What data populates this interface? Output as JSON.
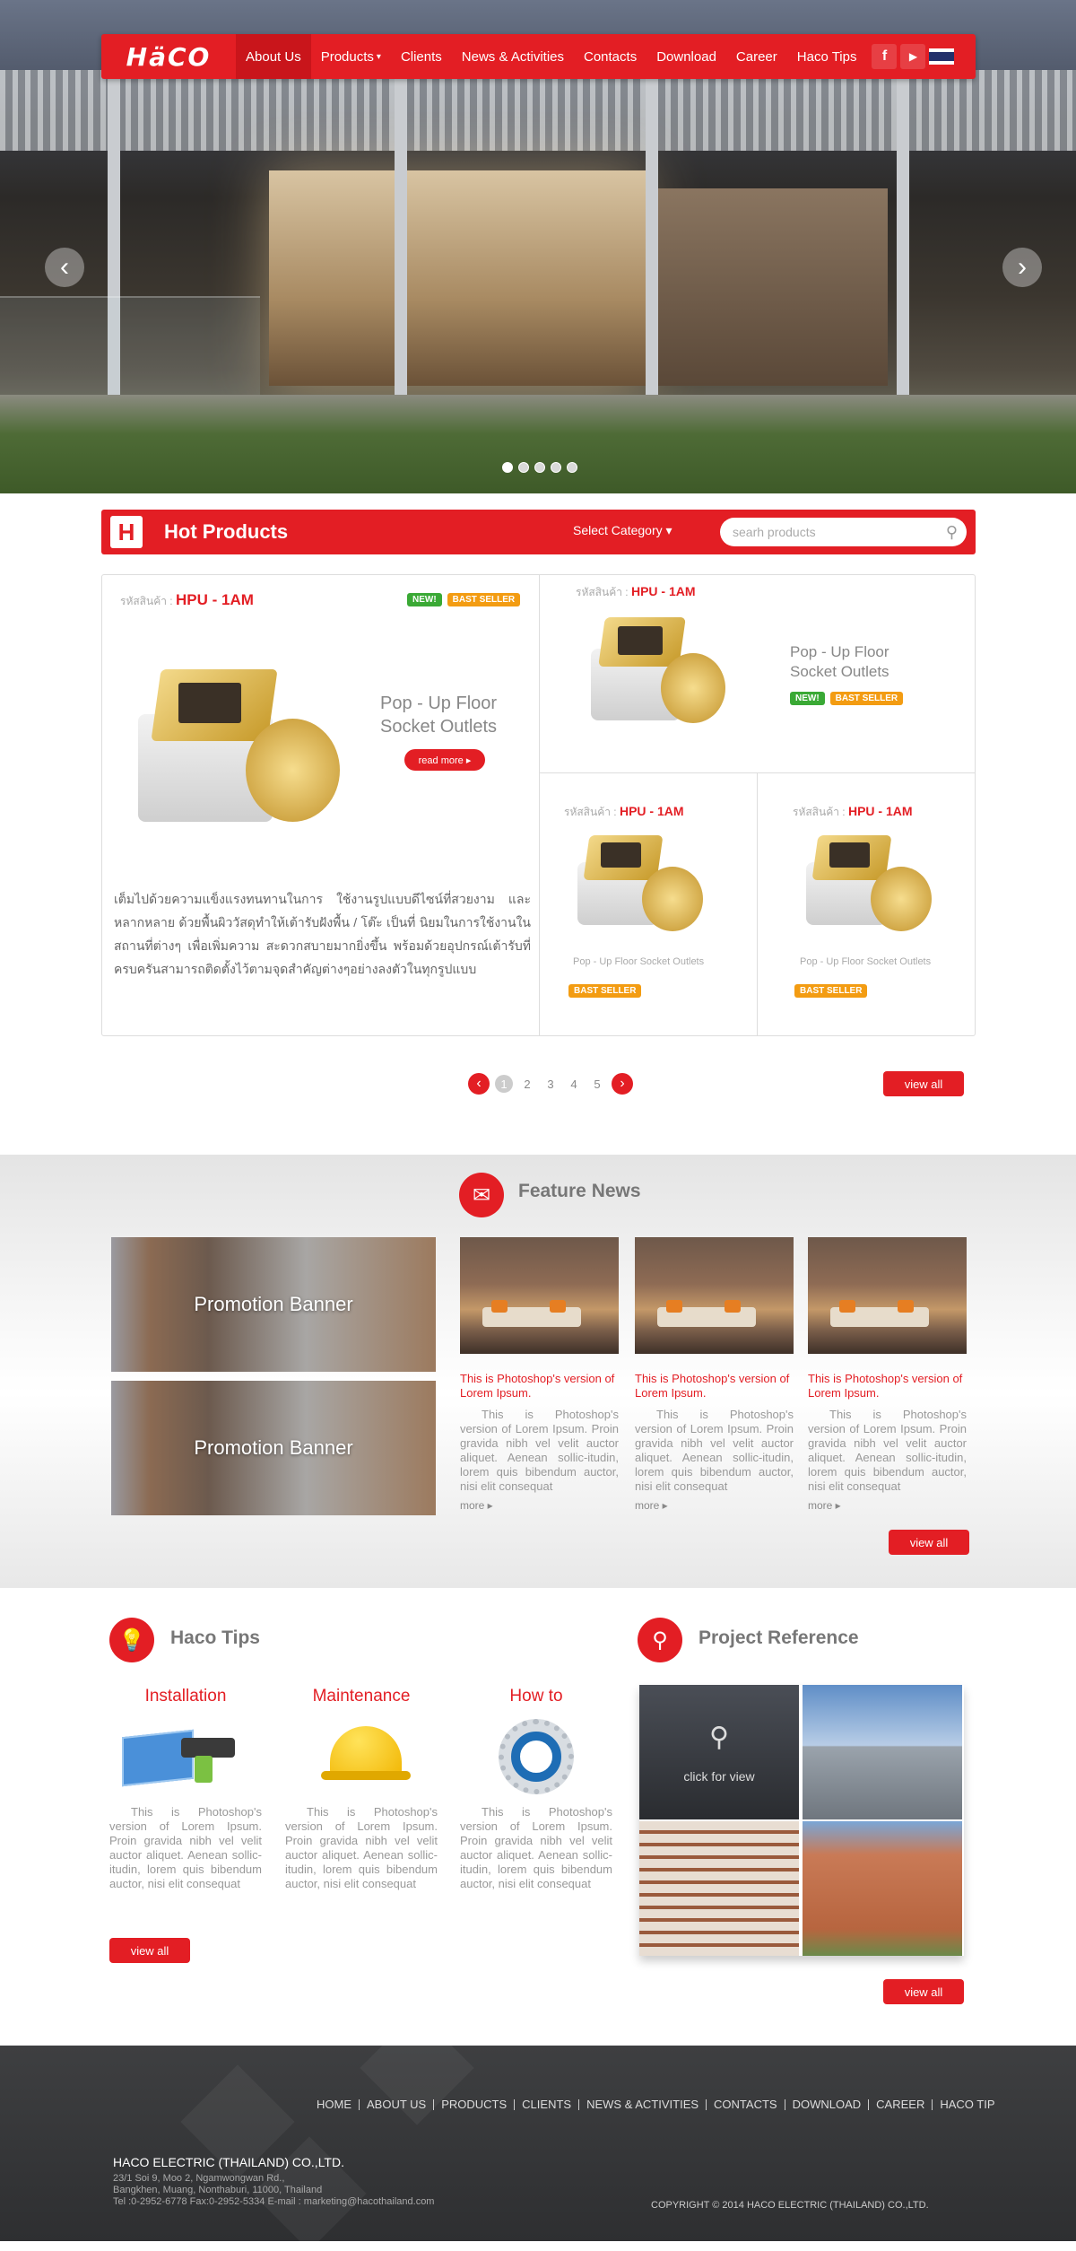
{
  "nav": {
    "logo": "HäCO",
    "items": [
      "About Us",
      "Products",
      "Clients",
      "News & Activities",
      "Contacts",
      "Download",
      "Career",
      "Haco Tips"
    ],
    "products_caret": "▾",
    "social": {
      "facebook": "f",
      "youtube": "▶",
      "thai_flag": ""
    }
  },
  "hero": {
    "prev": "‹",
    "next": "›",
    "dots": 5,
    "active_dot": 0
  },
  "hot": {
    "title": "Hot Products",
    "category": "Select Category ▾",
    "search_placeholder": "searh products",
    "code_prefix": "รหัสสินค้า : ",
    "featured": {
      "code": "HPU - 1AM",
      "name_line1": "Pop - Up Floor",
      "name_line2": "Socket Outlets",
      "read_more": "read more ▸",
      "badge_new": "NEW!",
      "badge_best": "BAST SELLER",
      "desc": "เต็มไปด้วยความแข็งแรงทนทานในการ         ใช้งานรูปแบบดีไซน์ที่สวยงาม และหลากหลาย ด้วยพื้นผิววัสดุทำให้เต้ารับฝังพื้น / โต๊ะ เป็นที่ นิยมในการใช้งานในสถานที่ต่างๆ เพื่อเพิ่มความ สะดวกสบายมากยิ่งขึ้น พร้อมด้วยอุปกรณ์เต้ารับที่ครบครันสามารถติดตั้งไว้ตามจุดสำคัญต่างๆอย่างลงตัวในทุกรูปแบบ"
    },
    "top_right": {
      "code": "HPU - 1AM",
      "name_line1": "Pop - Up Floor",
      "name_line2": "Socket Outlets",
      "badge_new": "NEW!",
      "badge_best": "BAST SELLER"
    },
    "bottom": [
      {
        "code": "HPU - 1AM",
        "name": "Pop - Up Floor Socket Outlets",
        "badge_best": "BAST SELLER"
      },
      {
        "code": "HPU - 1AM",
        "name": "Pop - Up Floor Socket Outlets",
        "badge_best": "BAST SELLER"
      }
    ],
    "pager": {
      "prev": "‹",
      "next": "›",
      "pages": [
        "1",
        "2",
        "3",
        "4",
        "5"
      ],
      "current": "1"
    },
    "view_all": "view all"
  },
  "feature": {
    "title": "Feature News",
    "banners": [
      "Promotion Banner",
      "Promotion Banner"
    ],
    "news": [
      {
        "title": "This is Photoshop's version of Lorem Ipsum.",
        "body": "This is Photoshop's version of Lorem Ipsum. Proin gravida nibh vel velit auctor aliquet. Aenean sollic-itudin, lorem quis bibendum auctor, nisi elit consequat",
        "more": "more ▸"
      },
      {
        "title": "This is Photoshop's version of Lorem Ipsum.",
        "body": "This is Photoshop's version of Lorem Ipsum. Proin gravida nibh vel velit auctor aliquet. Aenean sollic-itudin, lorem quis bibendum auctor, nisi elit consequat",
        "more": "more ▸"
      },
      {
        "title": "This is Photoshop's version of Lorem Ipsum.",
        "body": "This is Photoshop's version of Lorem Ipsum. Proin gravida nibh vel velit auctor aliquet. Aenean sollic-itudin, lorem quis bibendum auctor, nisi elit consequat",
        "more": "more ▸"
      }
    ],
    "view_all": "view all"
  },
  "tips": {
    "title": "Haco Tips",
    "items": [
      {
        "title": "Installation",
        "body": "This is Photoshop's version of Lorem Ipsum. Proin gravida nibh vel velit auctor aliquet. Aenean sollic-itudin, lorem quis bibendum auctor, nisi elit consequat"
      },
      {
        "title": "Maintenance",
        "body": "This is Photoshop's version of Lorem Ipsum. Proin gravida nibh vel velit auctor aliquet. Aenean sollic-itudin, lorem quis bibendum auctor, nisi elit consequat"
      },
      {
        "title": "How to",
        "body": "This is Photoshop's version of Lorem Ipsum. Proin gravida nibh vel velit auctor aliquet. Aenean sollic-itudin, lorem quis bibendum auctor, nisi elit consequat"
      }
    ],
    "view_all": "view all"
  },
  "project": {
    "title": "Project Reference",
    "click_for_view": "click for view",
    "view_all": "view all"
  },
  "footer": {
    "nav": [
      "HOME",
      "ABOUT US",
      "PRODUCTS",
      "CLIENTS",
      "NEWS & ACTIVITIES",
      "CONTACTS",
      "DOWNLOAD",
      "CAREER",
      "HACO TIP"
    ],
    "company": "HACO ELECTRIC (THAILAND) CO.,LTD.",
    "addr1": "23/1 Soi 9, Moo 2, Ngamwongwan Rd.,",
    "addr2": "Bangkhen, Muang, Nonthaburi, 11000, Thailand",
    "addr3": "Tel :0-2952-6778 Fax:0-2952-5334 E-mail : marketing@hacothailand.com",
    "copyright": "COPYRIGHT © 2014 HACO ELECTRIC (THAILAND) CO.,LTD."
  },
  "colors": {
    "brand_red": "#e31e24",
    "new_green": "#3aa935",
    "best_orange": "#f39c12"
  }
}
